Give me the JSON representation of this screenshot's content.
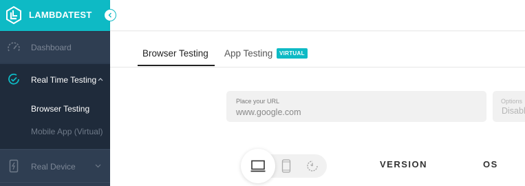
{
  "brand": {
    "name": "LAMBDATEST"
  },
  "sidebar": {
    "items": [
      {
        "label": "Dashboard",
        "icon": "speedometer-icon"
      },
      {
        "label": "Real Time Testing",
        "icon": "clock-icon",
        "expanded": true,
        "subitems": [
          {
            "label": "Browser Testing",
            "active": true
          },
          {
            "label": "Mobile App (Virtual)"
          }
        ]
      },
      {
        "label": "Real Device",
        "icon": "phone-bolt-icon"
      }
    ]
  },
  "tabs": [
    {
      "label": "Browser Testing",
      "active": true
    },
    {
      "label": "App Testing",
      "badge": "VIRTUAL"
    }
  ],
  "url_field": {
    "caption": "Place your URL",
    "placeholder": "www.google.com",
    "value": ""
  },
  "options_field": {
    "caption": "Options",
    "value": "Disable"
  },
  "device_toggle": {
    "options": [
      "desktop-icon",
      "mobile-icon",
      "clock-icon"
    ],
    "selected": "desktop-icon"
  },
  "columns": {
    "version": "VERSION",
    "os": "OS"
  },
  "colors": {
    "accent": "#0ebac5",
    "sidebar_bg": "#2b3a4e",
    "sidebar_active_bg": "#1f2b3b"
  }
}
